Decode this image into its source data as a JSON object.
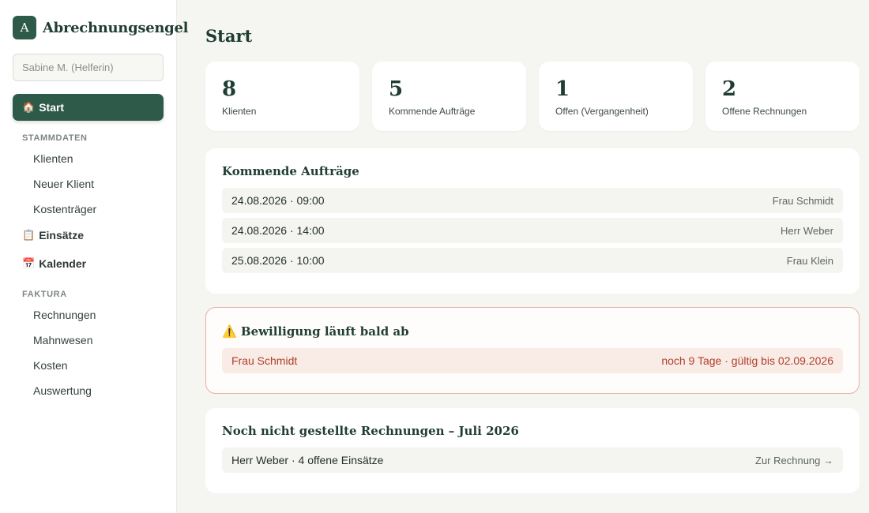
{
  "app": {
    "logo_letter": "A",
    "name": "Abrechnungsengel"
  },
  "user": {
    "label": "Sabine M. (Helferin)"
  },
  "nav": {
    "start": {
      "icon": "house-icon",
      "glyph": "🏠",
      "label": "Start"
    },
    "stammdaten": {
      "heading": "STAMMDATEN",
      "items": [
        "Klienten",
        "Neuer Klient",
        "Kostenträger"
      ]
    },
    "einsaetze": {
      "icon": "clipboard-icon",
      "glyph": "📋",
      "label": "Einsätze"
    },
    "kalender": {
      "icon": "calendar-icon",
      "glyph": "📅",
      "label": "Kalender"
    },
    "faktura": {
      "heading": "FAKTURA",
      "items": [
        "Rechnungen",
        "Mahnwesen",
        "Kosten",
        "Auswertung"
      ]
    }
  },
  "page": {
    "title": "Start"
  },
  "stats": [
    {
      "value": "8",
      "label": "Klienten"
    },
    {
      "value": "5",
      "label": "Kommende Aufträge"
    },
    {
      "value": "1",
      "label": "Offen (Vergangenheit)"
    },
    {
      "value": "2",
      "label": "Offene Rechnungen"
    }
  ],
  "upcoming": {
    "title": "Kommende Aufträge",
    "rows": [
      {
        "datetime": "24.08.2026 · 09:00",
        "client": "Frau Schmidt"
      },
      {
        "datetime": "24.08.2026 · 14:00",
        "client": "Herr Weber"
      },
      {
        "datetime": "25.08.2026 · 10:00",
        "client": "Frau Klein"
      }
    ]
  },
  "approval": {
    "icon": "warning-icon",
    "glyph": "⚠️",
    "title": "Bewilligung läuft bald ab",
    "rows": [
      {
        "client": "Frau Schmidt",
        "info": "noch 9 Tage · gültig bis 02.09.2026"
      }
    ]
  },
  "invoices": {
    "title": "Noch nicht gestellte Rechnungen – Juli 2026",
    "rows": [
      {
        "text": "Herr Weber · 4 offene Einsätze",
        "action": "Zur Rechnung →"
      }
    ]
  },
  "colors": {
    "accent": "#2d5a49",
    "warning": "#b1402a",
    "warning_bg": "#f9ebe6",
    "page_bg": "#f5f5f2"
  }
}
